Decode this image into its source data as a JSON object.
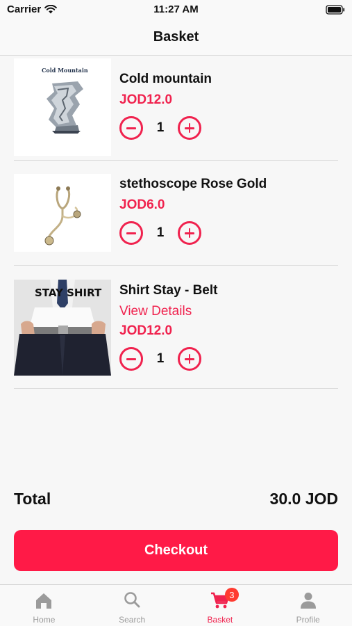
{
  "status_bar": {
    "carrier": "Carrier",
    "time": "11:27 AM"
  },
  "header": {
    "title": "Basket"
  },
  "basket": {
    "items": [
      {
        "name": "Cold mountain",
        "price": "JOD12.0",
        "quantity": "1",
        "thumb_text": "Cold Mountain"
      },
      {
        "name": "stethoscope Rose Gold",
        "price": "JOD6.0",
        "quantity": "1"
      },
      {
        "name": "Shirt Stay - Belt",
        "link": "View Details",
        "price": "JOD12.0",
        "quantity": "1",
        "thumb_text": "STAY SHIRT"
      }
    ]
  },
  "summary": {
    "total_label": "Total",
    "total_value": "30.0 JOD",
    "checkout_label": "Checkout"
  },
  "tab_bar": {
    "items": [
      {
        "label": "Home",
        "icon": "home-icon"
      },
      {
        "label": "Search",
        "icon": "search-icon"
      },
      {
        "label": "Basket",
        "icon": "cart-icon",
        "badge": "3"
      },
      {
        "label": "Profile",
        "icon": "person-icon"
      }
    ],
    "active": "Basket"
  },
  "colors": {
    "accent": "#f0224e",
    "checkout": "#ff1a47",
    "badge": "#ff3b30",
    "inactive_tab": "#9b9b9b"
  }
}
